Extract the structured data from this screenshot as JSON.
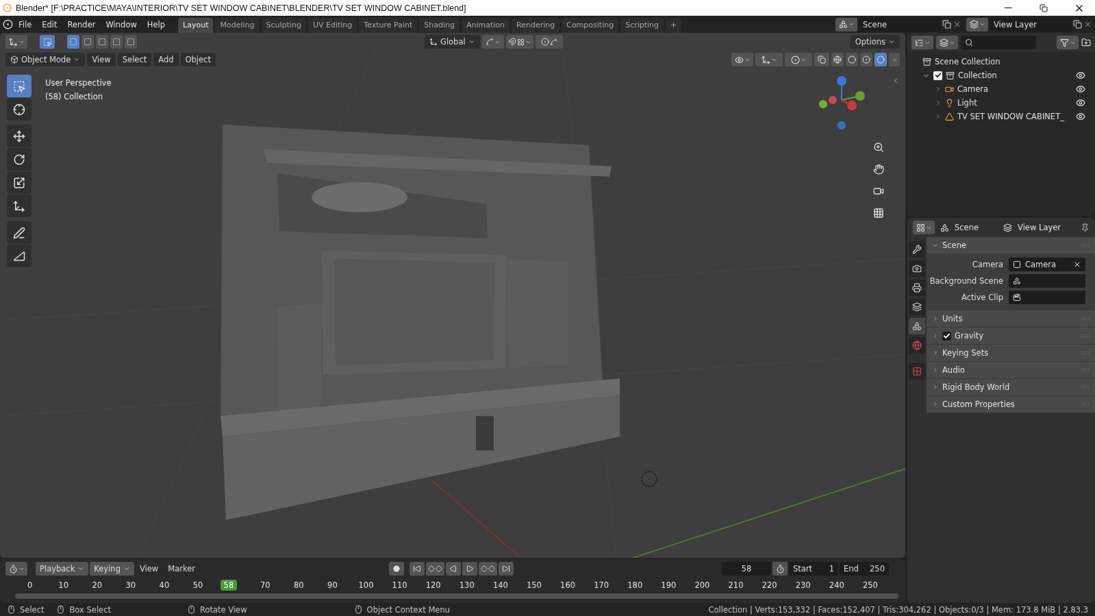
{
  "window": {
    "title": "Blender* [F:\\PRACTICE\\MAYA\\INTERIOR\\TV SET WINDOW CABINET\\BLENDER\\TV SET WINDOW CABINET.blend]"
  },
  "menu": [
    "File",
    "Edit",
    "Render",
    "Window",
    "Help"
  ],
  "workspaces": [
    {
      "label": "Layout",
      "selected": true
    },
    {
      "label": "Modeling",
      "selected": false
    },
    {
      "label": "Sculpting",
      "selected": false
    },
    {
      "label": "UV Editing",
      "selected": false
    },
    {
      "label": "Texture Paint",
      "selected": false
    },
    {
      "label": "Shading",
      "selected": false
    },
    {
      "label": "Animation",
      "selected": false
    },
    {
      "label": "Rendering",
      "selected": false
    },
    {
      "label": "Compositing",
      "selected": false
    },
    {
      "label": "Scripting",
      "selected": false
    }
  ],
  "add_workspace": "+",
  "scene_selector": {
    "value": "Scene"
  },
  "view_layer_selector": {
    "value": "View Layer"
  },
  "viewport": {
    "orientation": "Global",
    "options": "Options",
    "mode": "Object Mode",
    "menus": [
      "View",
      "Select",
      "Add",
      "Object"
    ],
    "overlay_text": [
      "User Perspective",
      "(58) Collection"
    ],
    "select_modes": [
      {
        "selected": true
      },
      {
        "selected": false
      },
      {
        "selected": false
      },
      {
        "selected": false
      },
      {
        "selected": false
      }
    ],
    "tools": [
      {
        "kind": "select",
        "selected": true
      },
      {
        "kind": "cursor",
        "selected": false
      },
      {
        "kind": "move",
        "selected": false
      },
      {
        "kind": "rotate",
        "selected": false
      },
      {
        "kind": "scale",
        "selected": false
      },
      {
        "kind": "transform",
        "selected": false
      },
      {
        "kind": "annotate",
        "selected": false
      },
      {
        "kind": "measure",
        "selected": false
      }
    ],
    "shading": [
      {
        "kind": "wireframe",
        "selected": false
      },
      {
        "kind": "solid",
        "selected": false
      },
      {
        "kind": "material",
        "selected": false
      },
      {
        "kind": "rendered",
        "selected": true
      }
    ]
  },
  "outliner": {
    "root": "Scene Collection",
    "items": [
      {
        "label": "Collection",
        "checked": true,
        "expanded": true,
        "visible": true,
        "children": [
          {
            "label": "Camera",
            "kind": "camera",
            "visible": true
          },
          {
            "label": "Light",
            "kind": "light",
            "visible": true
          },
          {
            "label": "TV SET WINDOW CABINET_",
            "kind": "mesh",
            "visible": true
          }
        ]
      }
    ]
  },
  "properties": {
    "breadcrumb": [
      "Scene",
      "View Layer"
    ],
    "tabs": [
      {
        "kind": "tool",
        "selected": false
      },
      {
        "kind": "render",
        "selected": false
      },
      {
        "kind": "output",
        "selected": false
      },
      {
        "kind": "view_layer",
        "selected": false
      },
      {
        "kind": "scene",
        "selected": true
      },
      {
        "kind": "world",
        "selected": false
      },
      {
        "kind": "texture",
        "selected": false
      }
    ],
    "panels": [
      {
        "title": "Scene",
        "expanded": true,
        "fields": [
          {
            "label": "Camera",
            "kind": "object",
            "value": "Camera"
          },
          {
            "label": "Background Scene",
            "kind": "scene"
          },
          {
            "label": "Active Clip",
            "kind": "clip"
          }
        ]
      },
      {
        "title": "Units",
        "expanded": false
      },
      {
        "title": "Gravity",
        "expanded": false,
        "checked": true
      },
      {
        "title": "Keying Sets",
        "expanded": false
      },
      {
        "title": "Audio",
        "expanded": false
      },
      {
        "title": "Rigid Body World",
        "expanded": false
      },
      {
        "title": "Custom Properties",
        "expanded": false
      }
    ]
  },
  "timeline": {
    "menus": [
      {
        "label": "Playback",
        "kind": "dropdown"
      },
      {
        "label": "Keying",
        "kind": "dropdown"
      },
      {
        "label": "View",
        "kind": "menu"
      },
      {
        "label": "Marker",
        "kind": "menu"
      }
    ],
    "current_frame": "58",
    "start_label": "Start",
    "start": "1",
    "end_label": "End",
    "end": "250",
    "ticks": [
      {
        "label": "0",
        "kind": "tick"
      },
      {
        "label": "10",
        "kind": "tick"
      },
      {
        "label": "20",
        "kind": "tick"
      },
      {
        "label": "30",
        "kind": "tick"
      },
      {
        "label": "40",
        "kind": "tick"
      },
      {
        "label": "50",
        "kind": "tick"
      },
      {
        "label": "58",
        "kind": "current"
      },
      {
        "label": "70",
        "kind": "tick"
      },
      {
        "label": "80",
        "kind": "tick"
      },
      {
        "label": "90",
        "kind": "tick"
      },
      {
        "label": "100",
        "kind": "tick"
      },
      {
        "label": "110",
        "kind": "tick"
      },
      {
        "label": "120",
        "kind": "tick"
      },
      {
        "label": "130",
        "kind": "tick"
      },
      {
        "label": "140",
        "kind": "tick"
      },
      {
        "label": "150",
        "kind": "tick"
      },
      {
        "label": "160",
        "kind": "tick"
      },
      {
        "label": "170",
        "kind": "tick"
      },
      {
        "label": "180",
        "kind": "tick"
      },
      {
        "label": "190",
        "kind": "tick"
      },
      {
        "label": "200",
        "kind": "tick"
      },
      {
        "label": "210",
        "kind": "tick"
      },
      {
        "label": "220",
        "kind": "tick"
      },
      {
        "label": "230",
        "kind": "tick"
      },
      {
        "label": "240",
        "kind": "tick"
      },
      {
        "label": "250",
        "kind": "tick"
      }
    ]
  },
  "status_bar": {
    "hints": [
      "Select",
      "Box Select",
      "Rotate View",
      "Object Context Menu"
    ],
    "stats": "Collection | Verts:153,332 | Faces:152,407 | Tris:304,262 | Objects:0/3 | Mem: 173.8 MiB | 2.83.3"
  }
}
